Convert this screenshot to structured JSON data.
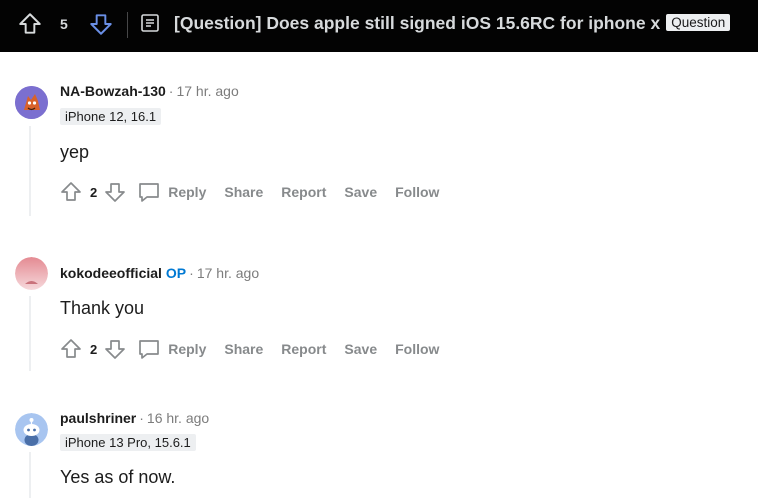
{
  "topbar": {
    "score": "5",
    "title": "[Question] Does apple still signed iOS 15.6RC for iphone x",
    "flair": "Question"
  },
  "comments": [
    {
      "author": "NA-Bowzah-130",
      "time": "17 hr. ago",
      "flair": "iPhone 12, 16.1",
      "body": "yep",
      "votes": "2",
      "actions": {
        "reply": "Reply",
        "share": "Share",
        "report": "Report",
        "save": "Save",
        "follow": "Follow"
      }
    },
    {
      "author": "kokodeeofficial",
      "op_label": "OP",
      "time": "17 hr. ago",
      "body": "Thank you",
      "votes": "2",
      "actions": {
        "reply": "Reply",
        "share": "Share",
        "report": "Report",
        "save": "Save",
        "follow": "Follow"
      }
    },
    {
      "author": "paulshriner",
      "time": "16 hr. ago",
      "flair": "iPhone 13 Pro, 15.6.1",
      "body": "Yes as of now."
    }
  ],
  "meta_separator": "·",
  "colors": {
    "topbar_bg": "#030303",
    "topbar_text": "#d7dadc",
    "op_accent": "#0079d3",
    "muted": "#878a8c"
  },
  "icons": {
    "upvote": "arrow-up-outline-icon",
    "downvote": "arrow-down-outline-icon",
    "post": "text-post-icon",
    "comment": "speech-bubble-icon"
  }
}
